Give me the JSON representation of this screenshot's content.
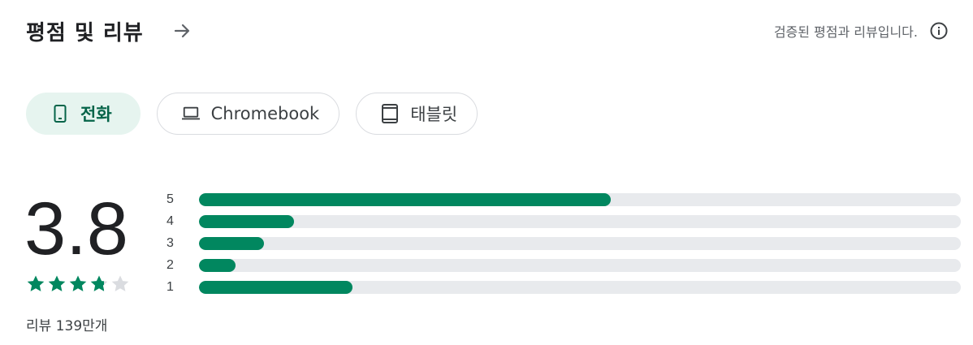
{
  "header": {
    "title": "평점 및 리뷰",
    "verified_text": "검증된 평점과 리뷰입니다."
  },
  "device_tabs": [
    {
      "label": "전화",
      "icon": "phone-icon",
      "selected": true
    },
    {
      "label": "Chromebook",
      "icon": "laptop-icon",
      "selected": false
    },
    {
      "label": "태블릿",
      "icon": "tablet-icon",
      "selected": false
    }
  ],
  "rating": {
    "score": "3.8",
    "stars_value": 3.8,
    "review_count": "리뷰 139만개",
    "histogram": [
      {
        "label": "5",
        "fraction": 0.54
      },
      {
        "label": "4",
        "fraction": 0.125
      },
      {
        "label": "3",
        "fraction": 0.085
      },
      {
        "label": "2",
        "fraction": 0.048
      },
      {
        "label": "1",
        "fraction": 0.202
      }
    ]
  },
  "colors": {
    "accent": "#01875f",
    "track": "#e8eaed",
    "chip_selected_bg": "#e6f4ef",
    "star_empty": "#dadce0"
  }
}
